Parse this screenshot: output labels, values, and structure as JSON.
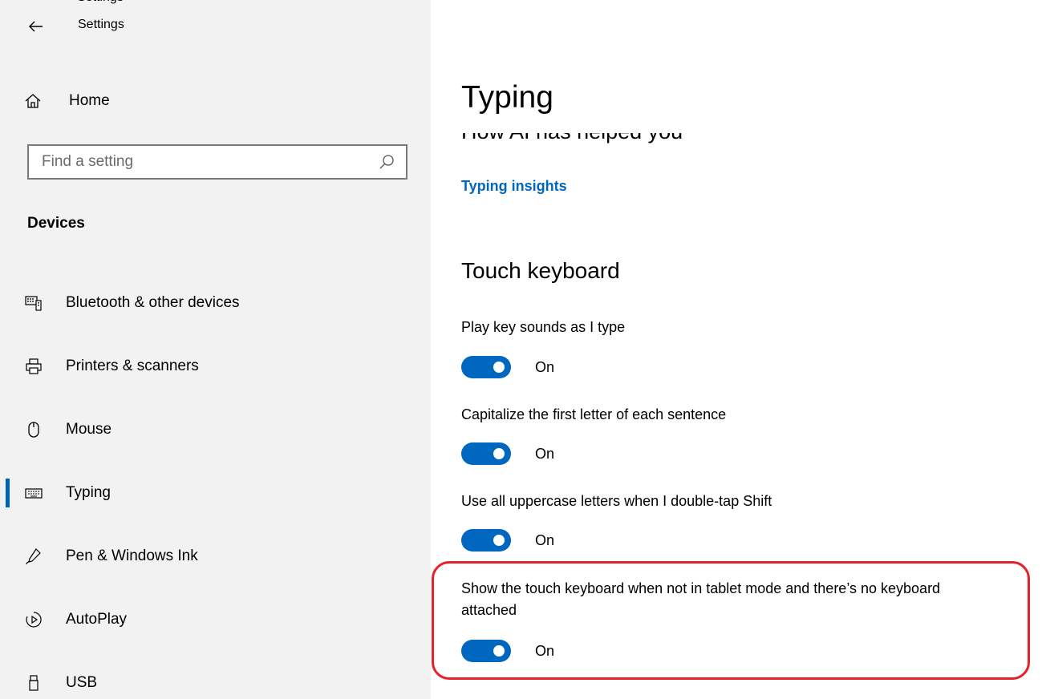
{
  "window": {
    "title": "Settings"
  },
  "sidebar": {
    "home_label": "Home",
    "search_placeholder": "Find a setting",
    "section_title": "Devices",
    "items": [
      {
        "label": "Bluetooth & other devices",
        "icon": "bluetooth-devices-icon",
        "selected": false
      },
      {
        "label": "Printers & scanners",
        "icon": "printer-icon",
        "selected": false
      },
      {
        "label": "Mouse",
        "icon": "mouse-icon",
        "selected": false
      },
      {
        "label": "Typing",
        "icon": "keyboard-icon",
        "selected": true
      },
      {
        "label": "Pen & Windows Ink",
        "icon": "pen-icon",
        "selected": false
      },
      {
        "label": "AutoPlay",
        "icon": "autoplay-icon",
        "selected": false
      },
      {
        "label": "USB",
        "icon": "usb-icon",
        "selected": false
      }
    ]
  },
  "main": {
    "page_title": "Typing",
    "partial_heading": "How AI has helped you",
    "insights_link": "Typing insights",
    "group_title": "Touch keyboard",
    "settings": [
      {
        "label": "Play key sounds as I type",
        "state": "On"
      },
      {
        "label": "Capitalize the first letter of each sentence",
        "state": "On"
      },
      {
        "label": "Use all uppercase letters when I double-tap Shift",
        "state": "On"
      },
      {
        "label": "Show the touch keyboard when not in tablet mode and there’s no keyboard attached",
        "state": "On"
      }
    ]
  },
  "colors": {
    "accent": "#0067c0",
    "highlight": "#e8202a",
    "sidebar_bg": "#f2f2f2"
  }
}
